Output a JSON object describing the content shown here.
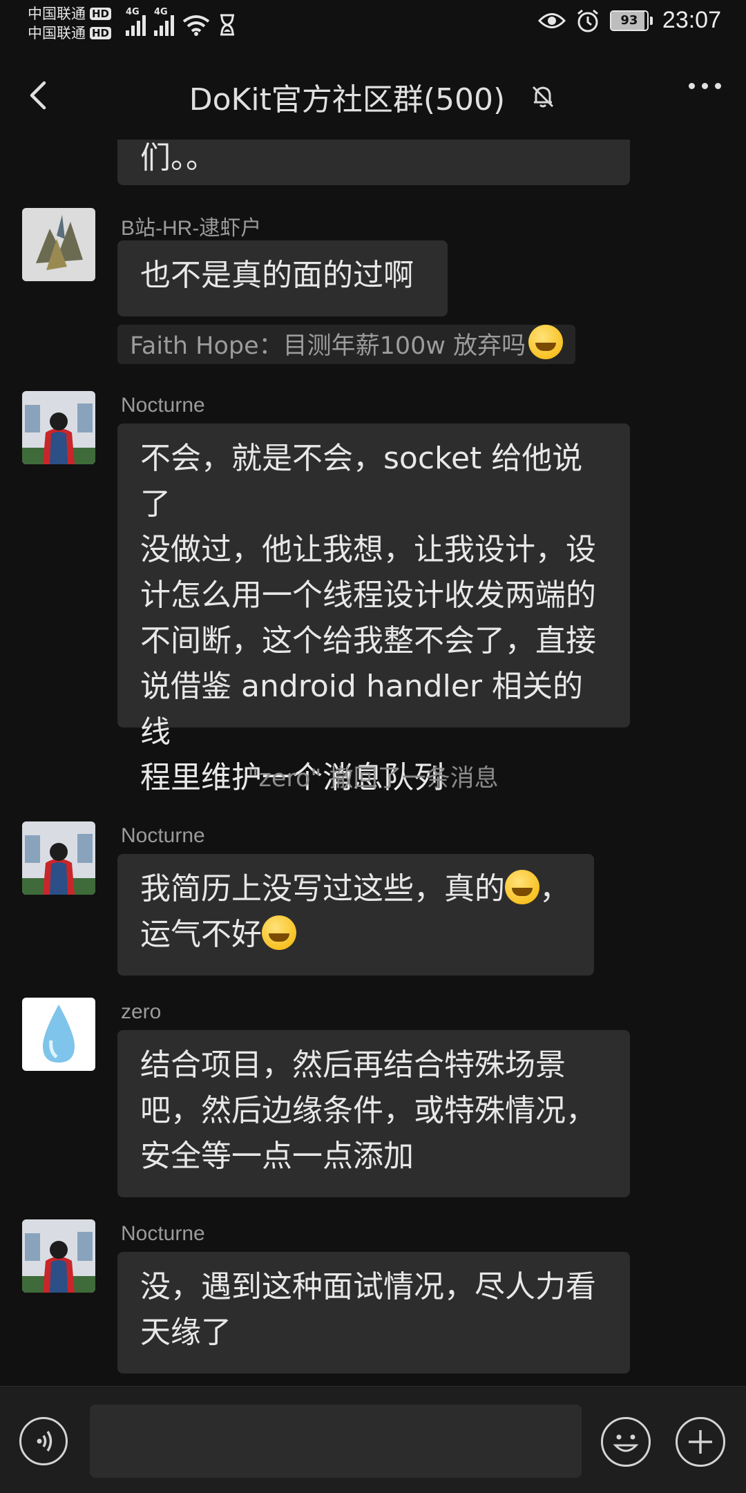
{
  "status_bar": {
    "carrier1": "中国联通",
    "carrier2": "中国联通",
    "hd_label": "HD",
    "net1": "4G",
    "net2": "4G",
    "battery": "93",
    "battery_level_percent": 93,
    "time": "23:07"
  },
  "header": {
    "title": "DoKit官方社区群(500)",
    "back_icon": "chevron-left-icon",
    "mute_icon": "bell-off-icon",
    "more_icon": "more-dots-icon"
  },
  "messages": [
    {
      "type": "partial",
      "text": "们。。"
    },
    {
      "type": "message",
      "sender": "B站-HR-逮虾户",
      "lines": [
        "也不是真的面的过啊"
      ]
    },
    {
      "type": "quote",
      "text": "Faith Hope：目测年薪100w 放弃吗"
    },
    {
      "type": "message",
      "sender": "Nocturne",
      "lines": [
        "不会，就是不会，socket 给他说了",
        "没做过，他让我想，让我设计，设",
        "计怎么用一个线程设计收发两端的",
        "不间断，这个给我整不会了，直接",
        "说借鉴 android handler 相关的线",
        "程里维护一个消息队列"
      ]
    },
    {
      "type": "system",
      "text": "\"zero\" 撤回了一条消息"
    },
    {
      "type": "message",
      "sender": "Nocturne",
      "lines": [
        "我简历上没写过这些，真的",
        "，",
        "运气不好"
      ]
    },
    {
      "type": "message",
      "sender": "zero",
      "lines": [
        "结合项目，然后再结合特殊场景",
        "吧，然后边缘条件，或特殊情况，",
        "安全等一点一点添加"
      ]
    },
    {
      "type": "message",
      "sender": "Nocturne",
      "lines": [
        "没，遇到这种面试情况，尽人力看",
        "天缘了"
      ]
    }
  ],
  "input_bar": {
    "voice_icon": "voice-icon",
    "emoji_icon": "smile-icon",
    "plus_icon": "plus-circle-icon"
  },
  "colors": {
    "background": "#111111",
    "bubble": "#2d2d2d",
    "sender": "#9b9b9b"
  }
}
